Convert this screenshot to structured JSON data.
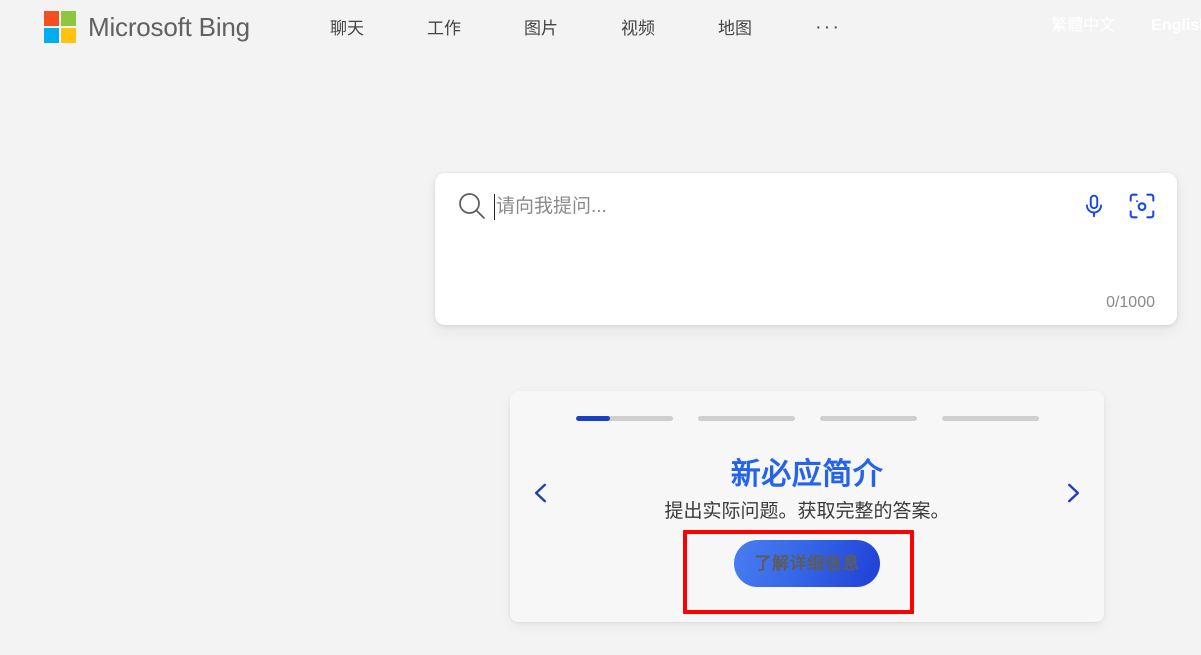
{
  "header": {
    "brand_name": "Microsoft Bing",
    "logo_icon": "microsoft-logo",
    "nav_items": [
      {
        "label": "聊天",
        "name": "chat"
      },
      {
        "label": "工作",
        "name": "work"
      },
      {
        "label": "图片",
        "name": "images"
      },
      {
        "label": "视频",
        "name": "videos"
      },
      {
        "label": "地图",
        "name": "maps"
      }
    ],
    "more_label": "···",
    "languages": [
      {
        "label": "繁體中文",
        "name": "traditional-chinese"
      },
      {
        "label": "English",
        "name": "english"
      }
    ]
  },
  "search": {
    "placeholder": "请向我提问...",
    "value": "",
    "search_icon": "search-icon",
    "mic_icon": "microphone-icon",
    "visual_search_icon": "visual-search-icon",
    "char_count": "0/1000",
    "max_chars": 1000,
    "current_chars": 0
  },
  "carousel": {
    "progress": [
      {
        "name": "slide-1",
        "fill_percent": 36
      },
      {
        "name": "slide-2",
        "fill_percent": 0
      },
      {
        "name": "slide-3",
        "fill_percent": 0
      },
      {
        "name": "slide-4",
        "fill_percent": 0
      }
    ],
    "active_index": 0,
    "title": "新必应简介",
    "subtitle": "提出实际问题。获取完整的答案。",
    "cta_label": "了解详细信息",
    "prev_icon": "chevron-left-icon",
    "next_icon": "chevron-right-icon"
  },
  "colors": {
    "page_background": "#f3f3f3",
    "card_background": "#f7f7f7",
    "accent_blue": "#2563eb",
    "progress_active": "#1a40c4",
    "progress_inactive": "#cfcfcf",
    "annotation_red": "#ff0000",
    "icon_blue": "#174ae4",
    "logo_orange": "#f25022",
    "logo_green": "#8dc63f",
    "logo_blue": "#00adef",
    "logo_yellow": "#ffc20e"
  }
}
